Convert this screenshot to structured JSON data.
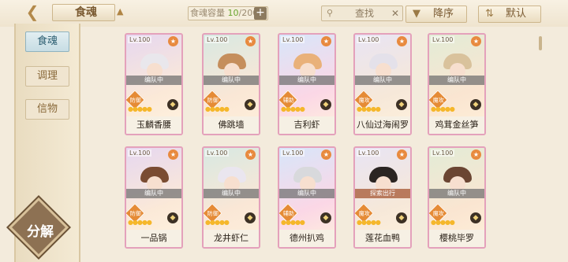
{
  "header": {
    "back_icon": "back-arrow-icon",
    "title": "食魂",
    "capacity_label": "食魂容量",
    "capacity_current": "10",
    "capacity_max": "/200",
    "search_placeholder": "查找",
    "sort_label": "降序",
    "default_label": "默认"
  },
  "sidebar": {
    "tabs": [
      "食魂",
      "调理",
      "信物"
    ],
    "active_tab": "食魂",
    "decompose_label": "分解"
  },
  "cards": [
    {
      "name": "玉麟香腰",
      "level": "Lv.100",
      "status": "编队中",
      "role": "防御"
    },
    {
      "name": "佛跳墙",
      "level": "Lv.100",
      "status": "编队中",
      "role": "防御"
    },
    {
      "name": "吉利虾",
      "level": "Lv.100",
      "status": "编队中",
      "role": "辅助"
    },
    {
      "name": "八仙过海闹罗汉",
      "level": "Lv.100",
      "status": "编队中",
      "role": "魔攻"
    },
    {
      "name": "鸡茸金丝笋",
      "level": "Lv.100",
      "status": "编队中",
      "role": "魔攻"
    },
    {
      "name": "一品锅",
      "level": "Lv.100",
      "status": "编队中",
      "role": "防御"
    },
    {
      "name": "龙井虾仁",
      "level": "Lv.100",
      "status": "编队中",
      "role": "防御"
    },
    {
      "name": "德州扒鸡",
      "level": "Lv.100",
      "status": "编队中",
      "role": "辅助"
    },
    {
      "name": "莲花血鸭",
      "level": "Lv.100",
      "status": "探索出行",
      "role": "魔攻"
    },
    {
      "name": "樱桃毕罗",
      "level": "Lv.100",
      "status": "编队中",
      "role": "魔攻"
    }
  ]
}
